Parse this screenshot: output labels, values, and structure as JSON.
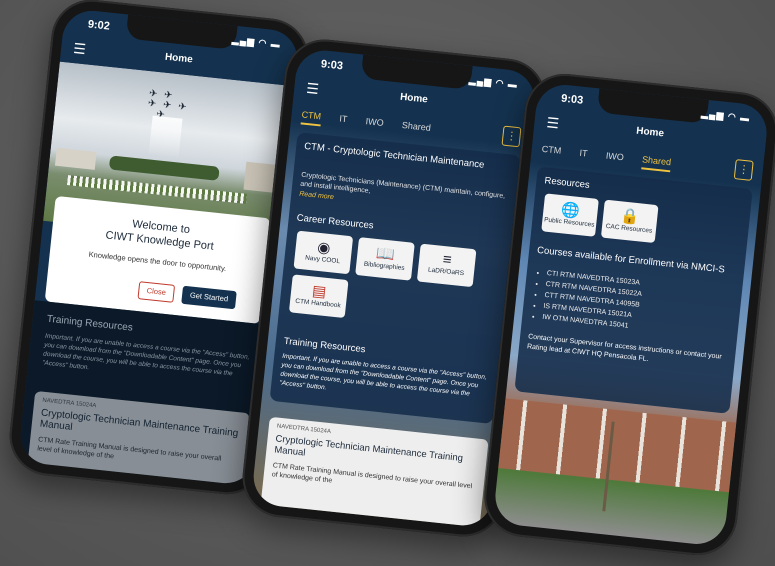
{
  "phone1": {
    "time": "9:02",
    "nav_title": "Home",
    "welcome_title_line1": "Welcome to",
    "welcome_title_line2": "CIWT Knowledge Port",
    "welcome_subtitle": "Knowledge opens the door to opportunity.",
    "close_label": "Close",
    "get_started_label": "Get Started",
    "training_heading": "Training Resources",
    "important_text": "Important. If you are unable to access a course via the \"Access\" button, you can download from the \"Downloadable Content\" page. Once you download the course, you will be able to access the course via the \"Access\" button.",
    "course_code": "NAVEDTRA 15024A",
    "course_title": "Cryptologic Technician Maintenance Training Manual",
    "course_desc": "CTM Rate Training Manual is designed to raise your overall level of knowledge of the"
  },
  "phone2": {
    "time": "9:03",
    "nav_title": "Home",
    "tabs": [
      "CTM",
      "IT",
      "IWO",
      "Shared"
    ],
    "rating_title": "CTM - Cryptologic Technician Maintenance",
    "rating_desc": "Cryptologic Technicians (Maintenance) (CTM) maintain, configure, and install intelligence,",
    "read_more": "Read more",
    "career_heading": "Career Resources",
    "career_items": [
      "Navy COOL",
      "Bibliographies",
      "LaDR/OaRS",
      "CTM Handbook"
    ],
    "training_heading": "Training Resources",
    "important_text": "Important. If you are unable to access a course via the \"Access\" button, you can download from the \"Downloadable Content\" page. Once you download the course, you will be able to access the course via the \"Access\" button.",
    "course_code": "NAVEDTRA 15024A",
    "course_title": "Cryptologic Technician Maintenance Training Manual",
    "course_desc": "CTM Rate Training Manual is designed to raise your overall level of knowledge of the"
  },
  "phone3": {
    "time": "9:03",
    "nav_title": "Home",
    "tabs": [
      "CTM",
      "IT",
      "IWO",
      "Shared"
    ],
    "resources_heading": "Resources",
    "resource_items": [
      "Public Resources",
      "CAC Resources"
    ],
    "courses_heading": "Courses available for Enrollment via NMCI-S",
    "courses": [
      "CTI RTM NAVEDTRA 15023A",
      "CTR RTM NAVEDTRA 15022A",
      "CTT RTM NAVEDTRA 14095B",
      "IS RTM NAVEDTRA 15021A",
      "IW OTM NAVEDTRA 15041"
    ],
    "contact_text": "Contact your Supervisor for access instructions or contact your Rating lead at CIWT HQ Pensacola FL."
  },
  "colors": {
    "navy": "#14324f",
    "gold": "#f0c341",
    "close_red": "#c0392b"
  }
}
